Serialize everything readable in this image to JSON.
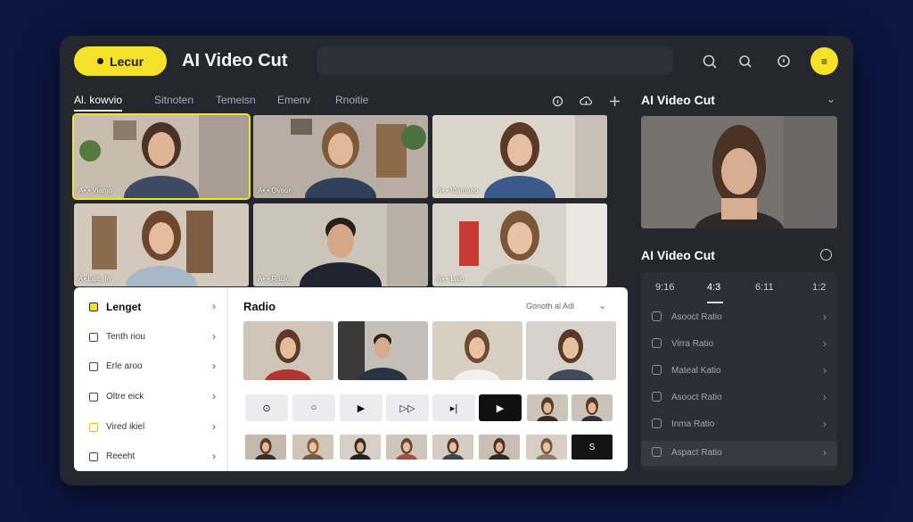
{
  "header": {
    "brand_label": "Lecur",
    "app_title": "AI Video Cut",
    "search_placeholder": "",
    "avatar_label": "≡"
  },
  "tabs": [
    {
      "label": "Al. kowvio",
      "active": true
    },
    {
      "label": "Sitnoten",
      "active": false
    },
    {
      "label": "Temeisn",
      "active": false
    },
    {
      "label": "Emenv",
      "active": false
    },
    {
      "label": "Rnoitie",
      "active": false
    }
  ],
  "grid": {
    "tiles": [
      {
        "label": "A• • Viamo",
        "selected": true
      },
      {
        "label": "A• • Oveor",
        "selected": false
      },
      {
        "label": "A• • Idamaeo",
        "selected": false
      },
      {
        "label": "A• Lalc, Ie",
        "selected": false
      },
      {
        "label": "A• • Rndio",
        "selected": false
      },
      {
        "label": "A• • Lalo",
        "selected": false
      }
    ]
  },
  "right_panel": {
    "title": "AI Video Cut",
    "subtitle": "AI Video Cut",
    "ratio_tabs": [
      "9:16",
      "4:3",
      "6:11",
      "1:2"
    ],
    "ratio_active_index": 1,
    "options": [
      {
        "label": "Asooct Ratio"
      },
      {
        "label": "Virra Ratio"
      },
      {
        "label": "Mateal Katio"
      },
      {
        "label": "Asooct Ratio"
      },
      {
        "label": "Inma Ratio"
      },
      {
        "label": "Aspact Ratio"
      }
    ]
  },
  "editor": {
    "sidebar": [
      {
        "label": "Lenget",
        "style": "yellow-fill",
        "bold": true
      },
      {
        "label": "Tenth riou",
        "style": "plain",
        "bold": false
      },
      {
        "label": "Erle aroo",
        "style": "plain",
        "bold": false
      },
      {
        "label": "Oltre eick",
        "style": "plain",
        "bold": false
      },
      {
        "label": "Vired ikiel",
        "style": "yellow-line",
        "bold": false
      },
      {
        "label": "Reeeht",
        "style": "plain",
        "bold": false
      }
    ],
    "title": "Radio",
    "filter_label": "Gonoth al Adl",
    "controls": [
      "⊙",
      "○",
      "▶",
      "▷▷",
      "▸|",
      "▶"
    ],
    "strip_last_label": "S"
  },
  "colors": {
    "accent": "#f5e02a",
    "background": "#0c1640",
    "panel": "#24272e"
  }
}
